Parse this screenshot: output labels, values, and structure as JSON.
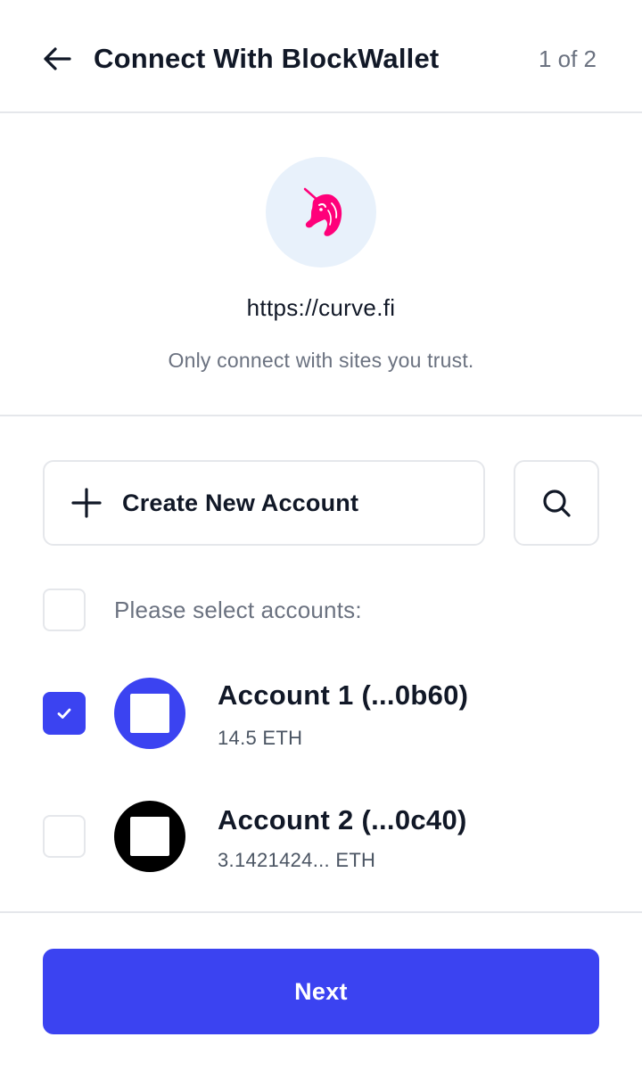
{
  "header": {
    "title": "Connect With BlockWallet",
    "step": "1 of 2",
    "back_icon": "arrow-left-icon"
  },
  "site": {
    "logo_icon": "uniswap-unicorn-icon",
    "url": "https://curve.fi",
    "note": "Only connect with sites you trust."
  },
  "actions": {
    "create_label": "Create New Account",
    "create_icon": "plus-icon",
    "search_icon": "search-icon"
  },
  "selection": {
    "select_all_label": "Please select accounts:",
    "select_all_checked": false
  },
  "accounts": [
    {
      "name": "Account 1 (...0b60)",
      "balance": "14.5 ETH",
      "checked": true,
      "avatar_color": "#3b43f1"
    },
    {
      "name": "Account 2 (...0c40)",
      "balance": "3.1421424... ETH",
      "checked": false,
      "avatar_color": "#000000"
    }
  ],
  "footer": {
    "next_label": "Next"
  },
  "colors": {
    "accent": "#3b43f1",
    "border": "#e5e7eb",
    "muted_text": "#6b7280",
    "logo_bg": "#e8f1fb",
    "logo_pink": "#ff007a"
  }
}
